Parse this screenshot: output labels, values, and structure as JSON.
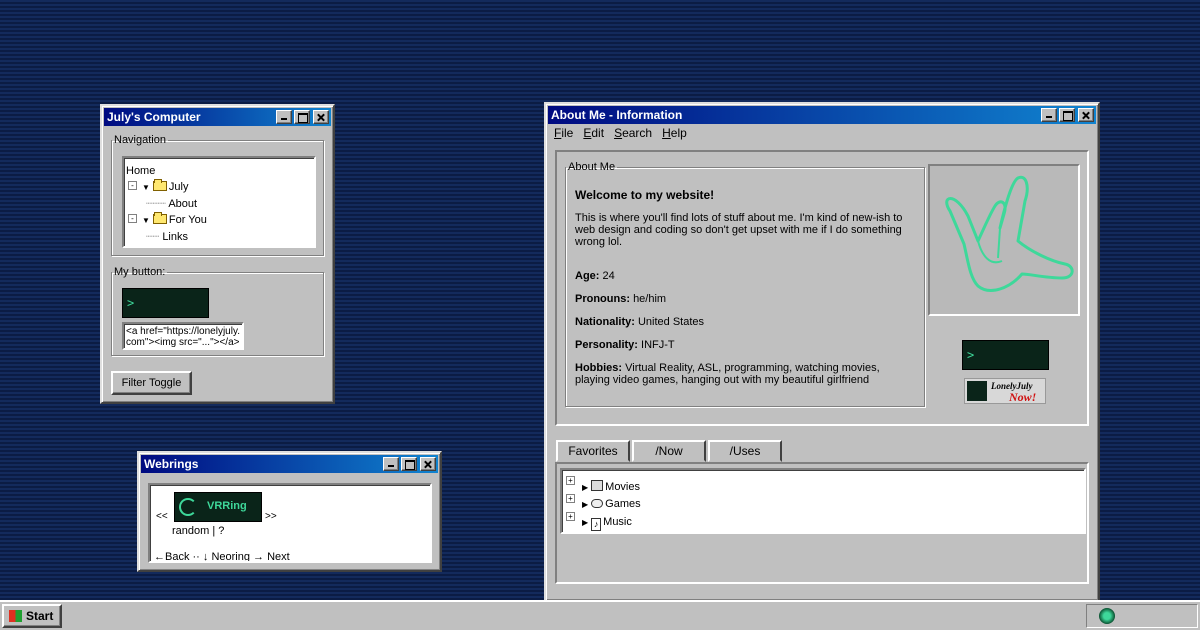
{
  "july_window": {
    "title": "July's Computer",
    "nav_legend": "Navigation",
    "tree": [
      {
        "label": "Home"
      },
      {
        "label": "July"
      },
      {
        "label": "About"
      },
      {
        "label": "For You"
      },
      {
        "label": "Links"
      }
    ],
    "button_legend": "My button:",
    "button_code": "<a href=\"https://lonelyjuly.com\"><img src=\"...\"></a>",
    "filter_label": "Filter Toggle"
  },
  "webrings_window": {
    "title": "Webrings",
    "prev": "<<",
    "next": ">>",
    "ring_name": "VRRing",
    "random_text": "random | ?",
    "footer": "←Back ·· ↓ Neoring → Next"
  },
  "about_window": {
    "title": "About Me - Information",
    "menu": [
      "File",
      "Edit",
      "Search",
      "Help"
    ],
    "legend": "About Me",
    "welcome": "Welcome to my website!",
    "intro": "This is where you'll find lots of stuff about me. I'm kind of new-ish to web design and coding so don't get upset with me if I do something wrong lol.",
    "fields": [
      {
        "label": "Age:",
        "value": "24"
      },
      {
        "label": "Pronouns:",
        "value": "he/him"
      },
      {
        "label": "Nationality:",
        "value": "United States"
      },
      {
        "label": "Personality:",
        "value": "INFJ-T"
      },
      {
        "label": "Hobbies:",
        "value": "Virtual Reality, ASL, programming, watching movies, playing video games, hanging out with my beautiful girlfriend"
      }
    ],
    "badge_text": "LonelyJuly",
    "badge_now": "Now!",
    "tabs": [
      "Favorites",
      "/Now",
      "/Uses"
    ],
    "favorites": [
      "Movies",
      "Games",
      "Music"
    ]
  },
  "taskbar": {
    "start": "Start"
  },
  "colors": {
    "accent_green": "#3ed89a",
    "title_start": "#000a80",
    "title_end": "#1084d0",
    "desktop": "#0f2350"
  }
}
